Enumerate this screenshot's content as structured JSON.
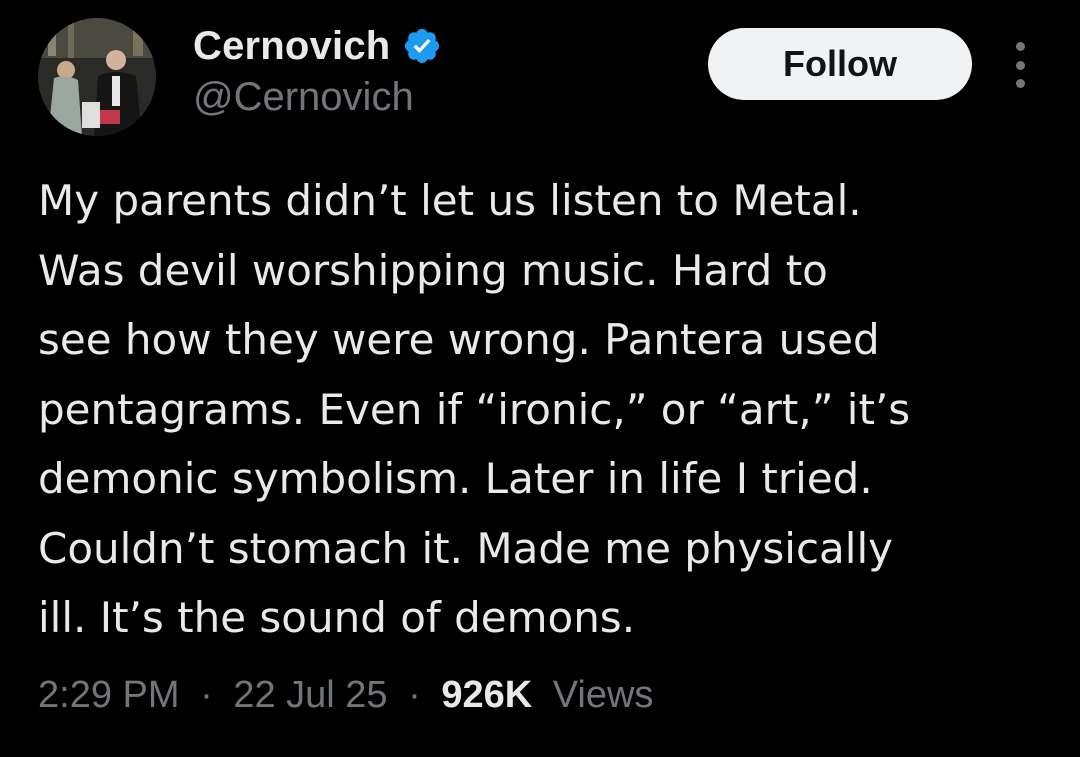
{
  "author": {
    "display_name": "Cernovich",
    "handle": "@Cernovich",
    "verified": true,
    "verified_color": "#1d9bf0"
  },
  "actions": {
    "follow_label": "Follow",
    "more_icon": "more-vertical-icon"
  },
  "tweet": {
    "lines": [
      "My parents didn’t let us listen to Metal.",
      "Was devil worshipping music. Hard to",
      "see how they were wrong. Pantera used",
      "pentagrams. Even if “ironic,” or “art,” it’s",
      "demonic symbolism. Later in life I tried.",
      "Couldn’t stomach it. Made me physically",
      "ill. It’s the sound of demons."
    ]
  },
  "meta": {
    "time": "2:29 PM",
    "separator": "·",
    "date": "22 Jul 25",
    "views_count": "926K",
    "views_label": "Views"
  },
  "colors": {
    "background": "#000000",
    "text": "#e7e9ea",
    "muted": "#71767b",
    "button_bg": "#eff3f4",
    "button_text": "#0f1419"
  }
}
